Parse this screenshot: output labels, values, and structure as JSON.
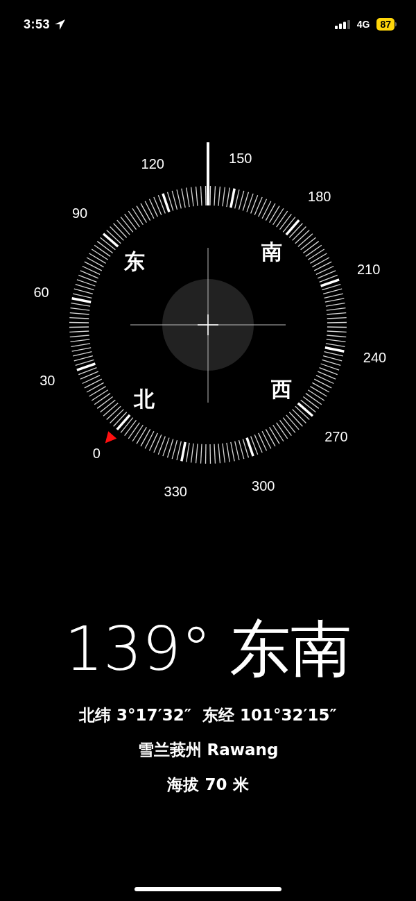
{
  "status_bar": {
    "time": "3:53",
    "network": "4G",
    "battery": "87"
  },
  "compass": {
    "degree_labels": [
      "0",
      "30",
      "60",
      "90",
      "120",
      "150",
      "180",
      "210",
      "240",
      "270",
      "300",
      "330"
    ],
    "cardinal_labels": [
      {
        "text": "东",
        "kind": "east"
      },
      {
        "text": "南",
        "kind": "south"
      },
      {
        "text": "北",
        "kind": "north"
      },
      {
        "text": "西",
        "kind": "west"
      }
    ]
  },
  "heading": {
    "degrees": "139°",
    "direction": "东南"
  },
  "location": {
    "coordinates": "北纬 3°17′32″  东经 101°32′15″",
    "place": "雪兰莪州 Rawang",
    "altitude": "海拔 70 米"
  }
}
